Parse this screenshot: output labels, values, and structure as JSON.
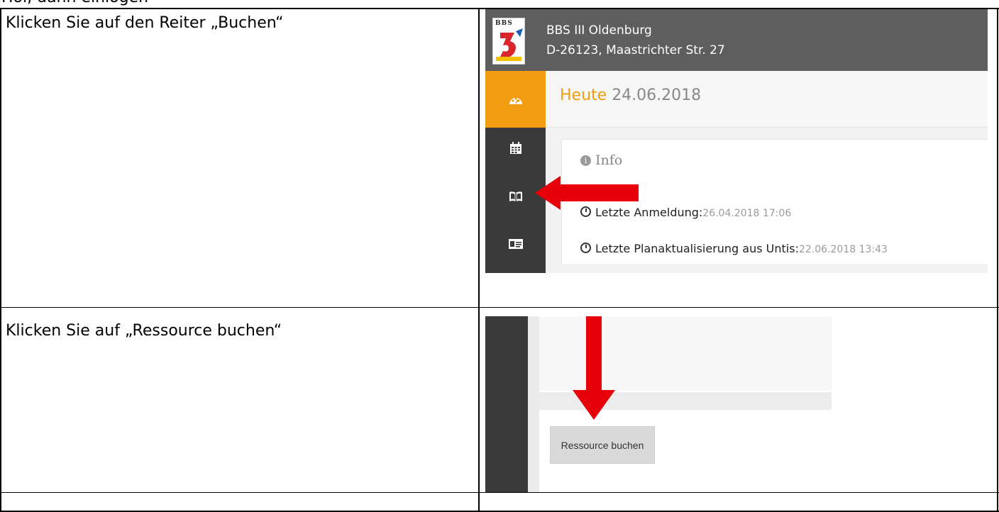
{
  "top_cut_text": "Hoi, dann einlogen",
  "rows": [
    {
      "instruction": "Klicken Sie auf den Reiter „Buchen“"
    },
    {
      "instruction": "Klicken Sie auf „Ressource buchen“"
    },
    {
      "instruction": ""
    }
  ],
  "screenshot1": {
    "logo_text": "BBS",
    "school_name": "BBS III Oldenburg",
    "school_address": "D-26123, Maastrichter Str. 27",
    "today_label": "Heute",
    "today_date": "24.06.2018",
    "sidebar_icons": [
      "dashboard-icon",
      "calendar-icon",
      "book-icon",
      "id-card-icon"
    ],
    "active_color": "#f39c12",
    "info_title": "Info",
    "last_login_label": "Letzte Anmeldung:",
    "last_login_value": "26.04.2018 17:06",
    "last_plan_label": "Letzte Planaktualisierung aus Untis:",
    "last_plan_value": "22.06.2018 13:43"
  },
  "screenshot2": {
    "button_label": "Ressource buchen"
  },
  "arrow_color": "#e8000b"
}
